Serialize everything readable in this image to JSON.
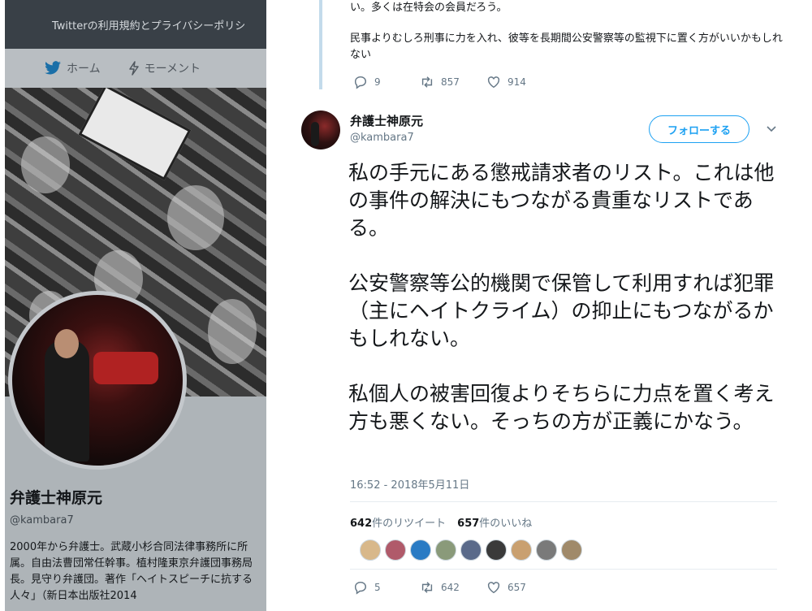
{
  "left_panel": {
    "topbar_text": "Twitterの利用規約とプライバシーポリシ",
    "nav": [
      {
        "label": "ホーム",
        "icon": "twitter-bird-icon"
      },
      {
        "label": "モーメント",
        "icon": "lightning-icon"
      }
    ],
    "profile": {
      "name": "弁護士神原元",
      "handle": "@kambara7",
      "bio": "2000年から弁護士。武蔵小杉合同法律事務所に所属。自由法曹団常任幹事。植村隆東京弁護団事務局長。見守り弁護団。著作「ヘイトスピーチに抗する人々」（新日本出版社2014"
    }
  },
  "previous_tweet": {
    "text_lines": [
      "い。多くは在特会の会員だろう。",
      "民事よりむしろ刑事に力を入れ、彼等を長期間公安警察等の監視下に置く方がいいかもしれない"
    ],
    "replies": "9",
    "retweets": "857",
    "likes": "914"
  },
  "tweet": {
    "author_name": "弁護士神原元",
    "author_handle": "@kambara7",
    "follow_label": "フォローする",
    "paragraphs": [
      "私の手元にある懲戒請求者のリスト。これは他の事件の解決にもつながる貴重なリストである。",
      "公安警察等公的機関で保管して利用すれば犯罪（主にヘイトクライム）の抑止にもつながるかもしれない。",
      "私個人の被害回復よりそちらに力点を置く考え方も悪くない。そっちの方が正義にかなう。"
    ],
    "timestamp": "16:52 - 2018年5月11日",
    "retweet_count": "642",
    "retweet_suffix": "件のリツイート",
    "like_count": "657",
    "like_suffix": "件のいいね",
    "liker_colors": [
      "#d8b88a",
      "#b05a6a",
      "#2a7bc4",
      "#8a9a7a",
      "#5a6a8a",
      "#3a3a3a",
      "#c9a070",
      "#7a7a7a",
      "#a08a6a"
    ],
    "replies": "5",
    "retweets": "642",
    "likes": "657"
  },
  "colors": {
    "accent": "#1da1f2",
    "muted": "#657786"
  }
}
